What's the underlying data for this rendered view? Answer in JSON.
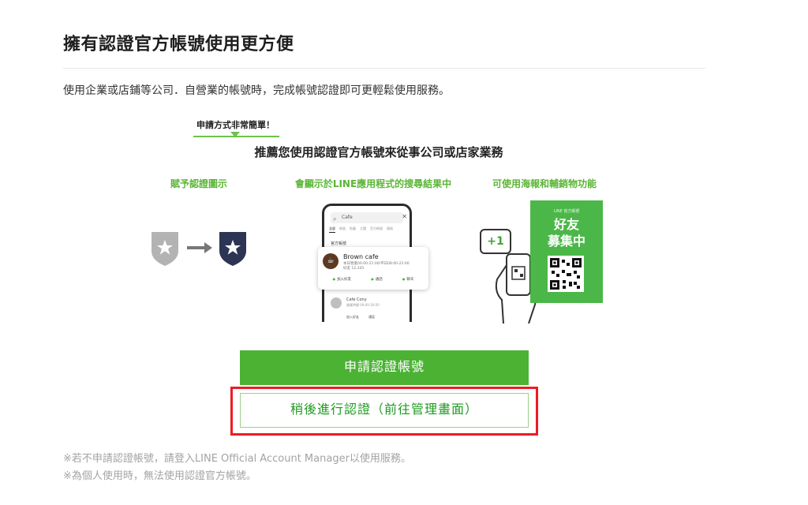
{
  "page": {
    "title": "擁有認證官方帳號使用更方便",
    "intro": "使用企業或店鋪等公司．自營業的帳號時，完成帳號認證即可更輕鬆使用服務。"
  },
  "promo": {
    "bubble": "申請方式非常簡單！",
    "headline": "推薦您使用認證官方帳號來從事公司或店家業務",
    "features": [
      {
        "label": "賦予認證圖示"
      },
      {
        "label": "會顯示於LINE應用程式的搜尋結果中"
      },
      {
        "label": "可使用海報和輔銷物功能"
      }
    ],
    "phone": {
      "search_value": "Cafe",
      "tabs": [
        "全部",
        "帳號",
        "貼圖",
        "主題",
        "官方帳號",
        "服務"
      ],
      "section": "官方帳號",
      "card": {
        "name": "Brown cafe",
        "meta_line1": "本日營業00:00-21:00/平日08:00-22:00",
        "meta_line2": "好友 12,345",
        "actions": [
          "加入好友",
          "通話",
          "聊天"
        ]
      },
      "second_item": {
        "name": "Cafe Cony",
        "meta": "營業時間 09:00-20:00",
        "actions": [
          "加入好友",
          "通話"
        ]
      }
    },
    "poster": {
      "top_label": "LINE 官方帳號",
      "title_line1": "好友",
      "title_line2": "募集中",
      "plus_badge": "+1"
    },
    "colors": {
      "green": "#4cb234",
      "highlight_red": "#ec1c24",
      "badge_gray": "#b3b3b3",
      "badge_navy": "#2c3553"
    }
  },
  "buttons": {
    "apply": "申請認證帳號",
    "later": "稍後進行認證（前往管理畫面）"
  },
  "notes": [
    "※若不申請認證帳號，請登入LINE Official Account Manager以使用服務。",
    "※為個人使用時，無法使用認證官方帳號。"
  ]
}
